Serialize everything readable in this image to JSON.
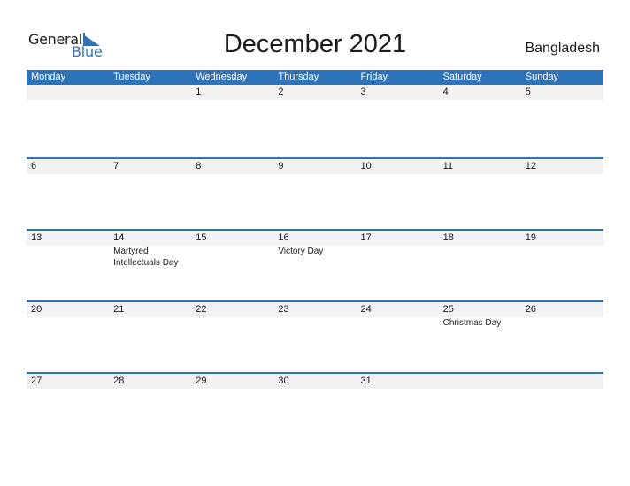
{
  "logo": {
    "general": "General",
    "blue": "Blue"
  },
  "title": "December 2021",
  "country": "Bangladesh",
  "colors": {
    "accent": "#2e72b8",
    "date_strip": "#f2f2f2"
  },
  "weekdays": [
    "Monday",
    "Tuesday",
    "Wednesday",
    "Thursday",
    "Friday",
    "Saturday",
    "Sunday"
  ],
  "weeks": [
    {
      "days": [
        "",
        "",
        "1",
        "2",
        "3",
        "4",
        "5"
      ],
      "events": [
        "",
        "",
        "",
        "",
        "",
        "",
        ""
      ]
    },
    {
      "days": [
        "6",
        "7",
        "8",
        "9",
        "10",
        "11",
        "12"
      ],
      "events": [
        "",
        "",
        "",
        "",
        "",
        "",
        ""
      ]
    },
    {
      "days": [
        "13",
        "14",
        "15",
        "16",
        "17",
        "18",
        "19"
      ],
      "events": [
        "",
        "Martyred Intellectuals Day",
        "",
        "Victory Day",
        "",
        "",
        ""
      ]
    },
    {
      "days": [
        "20",
        "21",
        "22",
        "23",
        "24",
        "25",
        "26"
      ],
      "events": [
        "",
        "",
        "",
        "",
        "",
        "Christmas Day",
        ""
      ]
    },
    {
      "days": [
        "27",
        "28",
        "29",
        "30",
        "31",
        "",
        ""
      ],
      "events": [
        "",
        "",
        "",
        "",
        "",
        "",
        ""
      ]
    }
  ]
}
